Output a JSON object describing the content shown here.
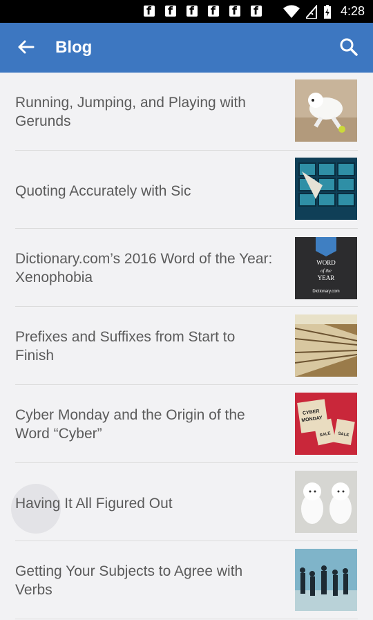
{
  "status_bar": {
    "time": "4:28",
    "notification_icons": [
      "facebook-icon",
      "facebook-icon",
      "facebook-icon",
      "facebook-icon",
      "facebook-icon",
      "facebook-icon"
    ],
    "system_icons": [
      "wifi-icon",
      "no-sim-icon",
      "battery-charging-icon"
    ]
  },
  "toolbar": {
    "title": "Blog",
    "back_icon": "arrow-back-icon",
    "search_icon": "search-icon",
    "background": "#3d77c1"
  },
  "articles": [
    {
      "title": "Running, Jumping, and Playing with Gerunds"
    },
    {
      "title": "Quoting Accurately with Sic"
    },
    {
      "title": "Dictionary.com’s 2016 Word of the Year: Xenophobia",
      "thumb_text": [
        "WORD",
        "of the",
        "YEAR",
        "Dictionary.com"
      ]
    },
    {
      "title": "Prefixes and Suffixes from Start to Finish"
    },
    {
      "title": "Cyber Monday and the Origin of the Word “Cyber”",
      "thumb_text": [
        "CYBER",
        "MONDAY",
        "SALE",
        "SALE"
      ]
    },
    {
      "title": "Having It All Figured Out"
    },
    {
      "title": "Getting Your Subjects to Agree with Verbs"
    }
  ]
}
